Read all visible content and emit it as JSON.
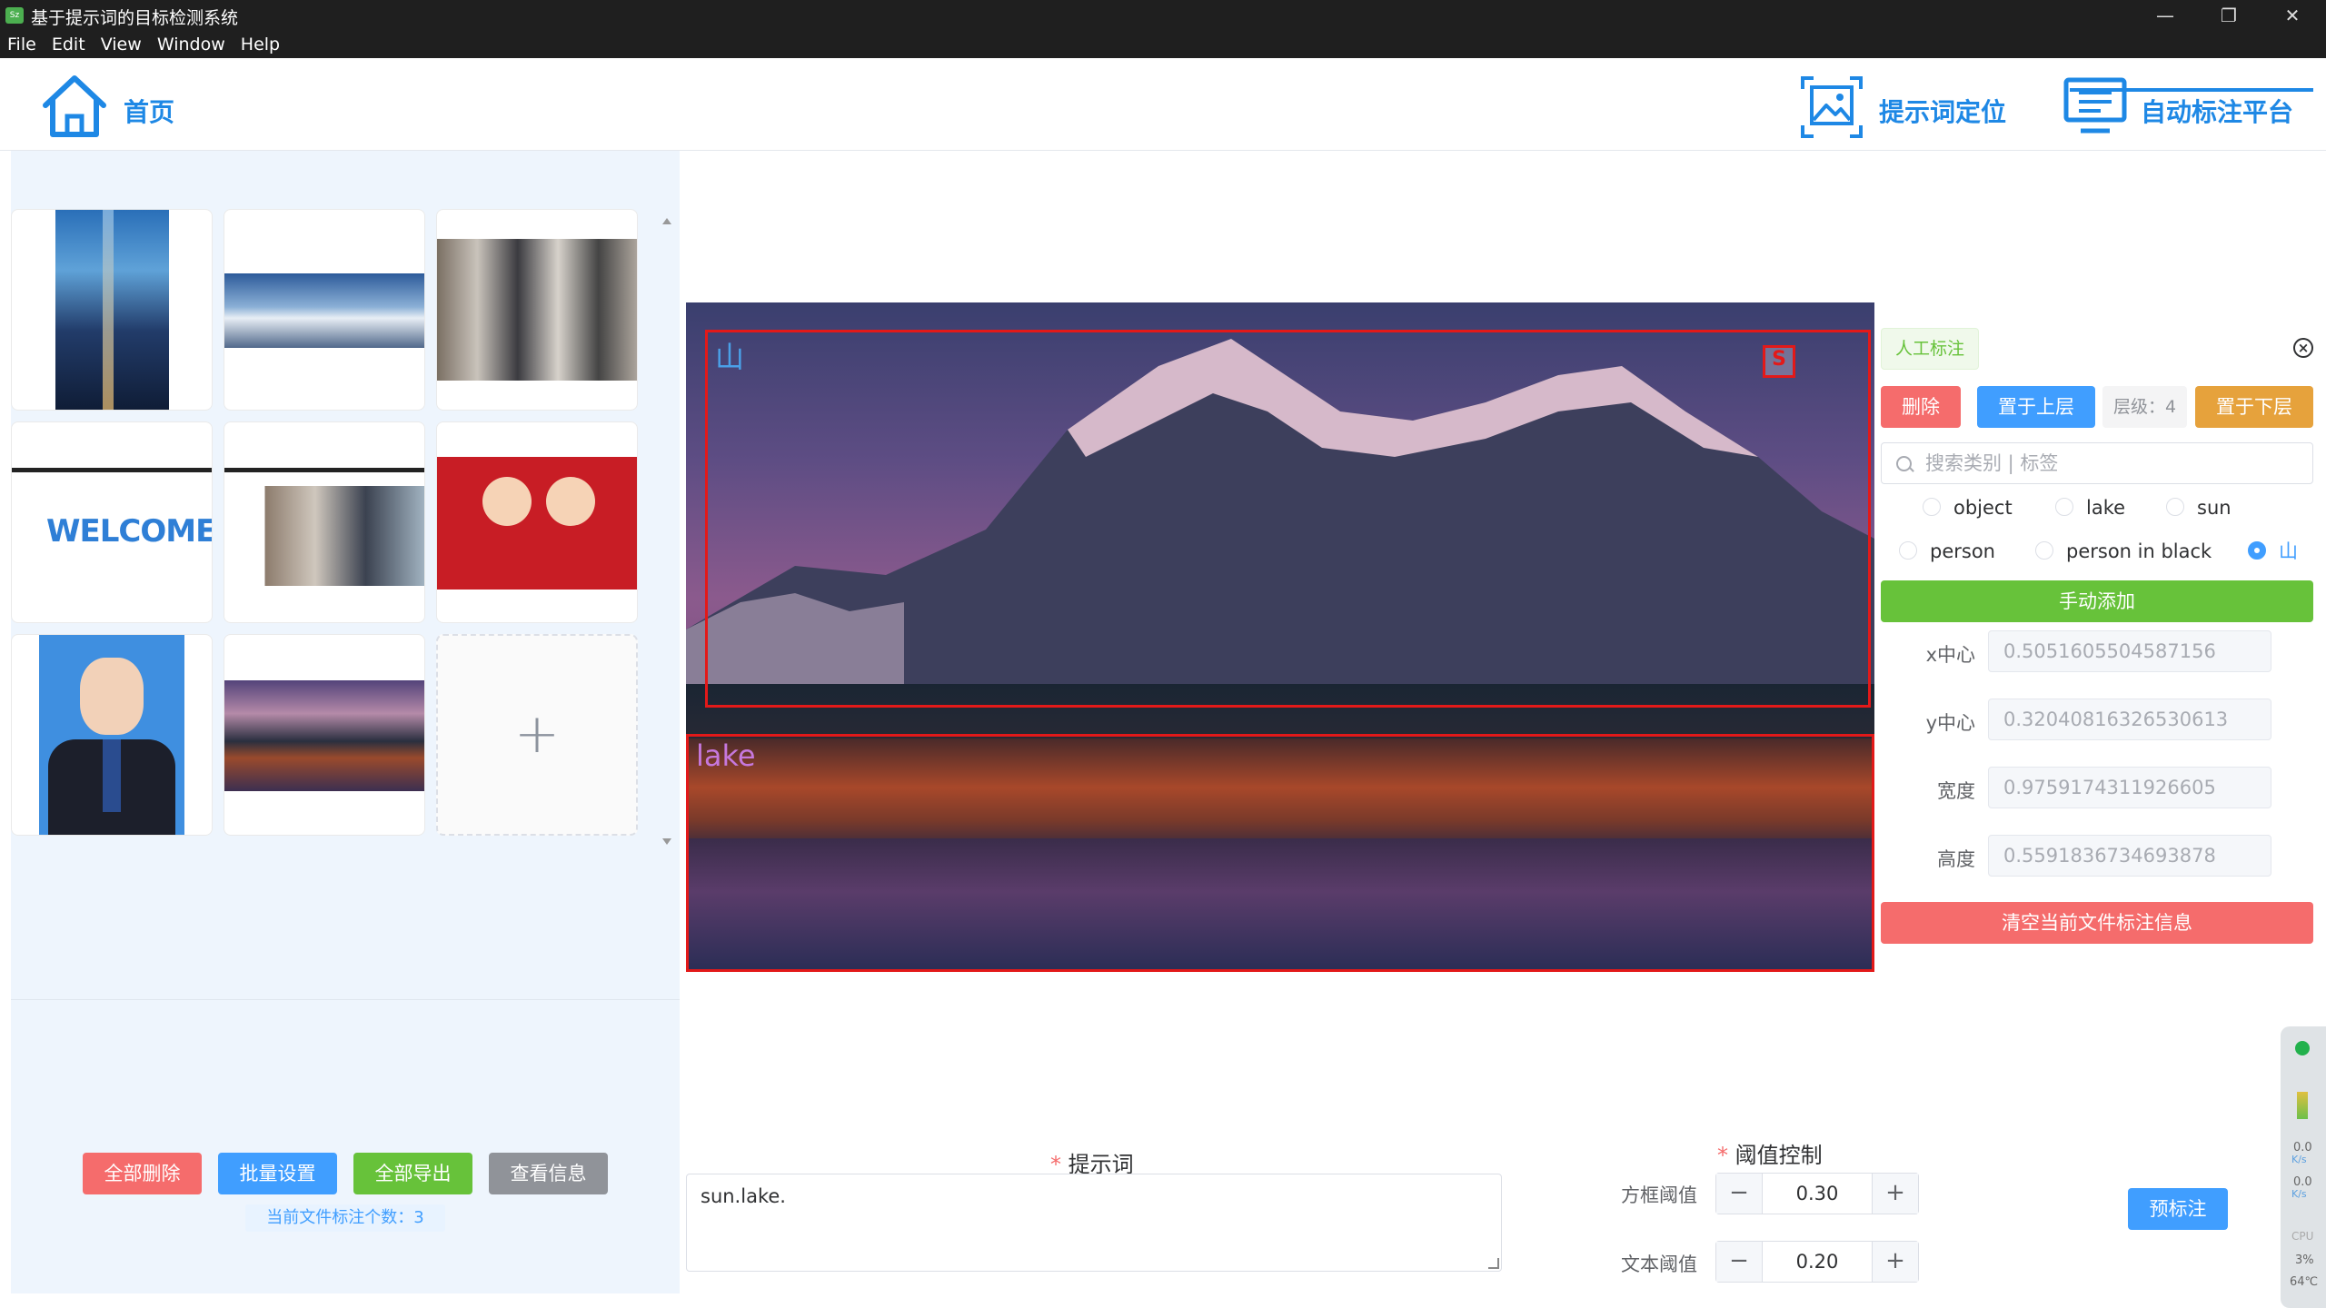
{
  "window": {
    "title": "基于提示词的目标检测系统",
    "icon_text": "Sz",
    "controls": [
      "—",
      "❐",
      "✕"
    ]
  },
  "menu": [
    "File",
    "Edit",
    "View",
    "Window",
    "Help"
  ],
  "header": {
    "home_label": "首页",
    "nav": [
      {
        "label": "提示词定位",
        "icon": "image-frame-icon",
        "active": false
      },
      {
        "label": "自动标注平台",
        "icon": "monitor-icon",
        "active": true
      }
    ],
    "accent": "#1e88e5"
  },
  "gallery": {
    "thumbnails": [
      {
        "desc": "night-city-road"
      },
      {
        "desc": "mountain-panorama"
      },
      {
        "desc": "crowd-street"
      },
      {
        "desc": "welcome-banner"
      },
      {
        "desc": "app-screenshot"
      },
      {
        "desc": "cartoon-couple"
      },
      {
        "desc": "id-photo"
      },
      {
        "desc": "mountain-lake"
      }
    ],
    "add_symbol": "+"
  },
  "left_actions": {
    "delete_all": "全部删除",
    "batch_settings": "批量设置",
    "export_all": "全部导出",
    "view_info": "查看信息",
    "count_text": "当前文件标注个数：3"
  },
  "canvas": {
    "labels": {
      "mountain": "山",
      "lake": "lake",
      "sun": "S"
    },
    "box_color": "#e31919"
  },
  "annotation_panel": {
    "manual_tag": "人工标注",
    "delete": "删除",
    "bring_up": "置于上层",
    "level": "层级：4",
    "send_down": "置于下层",
    "search_placeholder": "搜索类别 | 标签",
    "categories": [
      "object",
      "lake",
      "sun",
      "person",
      "person in black",
      "山"
    ],
    "selected_category": "山",
    "manual_add": "手动添加",
    "props": [
      {
        "label": "x中心",
        "value": "0.5051605504587156"
      },
      {
        "label": "y中心",
        "value": "0.32040816326530613"
      },
      {
        "label": "宽度",
        "value": "0.9759174311926605"
      },
      {
        "label": "高度",
        "value": "0.5591836734693878"
      }
    ],
    "clear": "清空当前文件标注信息"
  },
  "prompt": {
    "label": "提示词",
    "required_mark": "*",
    "value": "sun.lake."
  },
  "threshold": {
    "label": "阈值控制",
    "required_mark": "*",
    "box_label": "方框阈值",
    "box_value": "0.30",
    "text_label": "文本阈值",
    "text_value": "0.20",
    "minus": "−",
    "plus": "+"
  },
  "pre_annotate": "预标注",
  "tray": {
    "net_up": "0.0",
    "net_up_unit": "K/s",
    "net_down": "0.0",
    "net_down_unit": "K/s",
    "cpu_label": "CPU",
    "cpu_value": "3%",
    "temp": "64℃"
  }
}
